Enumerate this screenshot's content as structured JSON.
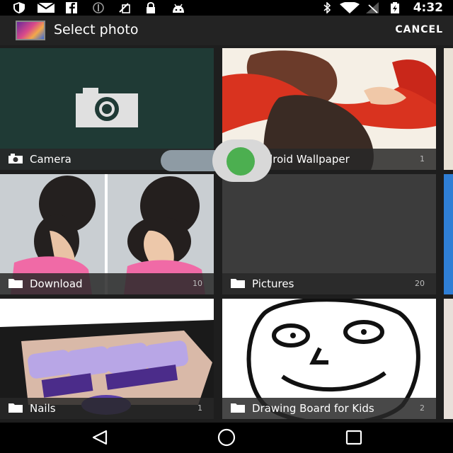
{
  "status_bar": {
    "time": "4:32",
    "icons": [
      "shield-icon",
      "mail-icon",
      "facebook-icon",
      "blocked-icon",
      "no-sim-icon",
      "lock-icon",
      "android-icon",
      "bluetooth-icon",
      "wifi-icon",
      "no-signal-icon",
      "battery-charging-icon"
    ]
  },
  "app_bar": {
    "title": "Select photo",
    "cancel_label": "CANCEL"
  },
  "albums": [
    {
      "name": "Camera",
      "count": "",
      "icon": "camera-icon"
    },
    {
      "name": "Android Wallpaper",
      "count": "1",
      "icon": "folder-icon"
    },
    {
      "name": "Download",
      "count": "10",
      "icon": "folder-icon"
    },
    {
      "name": "Pictures",
      "count": "20",
      "icon": "folder-icon"
    },
    {
      "name": "Nails",
      "count": "1",
      "icon": "folder-icon"
    },
    {
      "name": "Drawing Board for Kids",
      "count": "2",
      "icon": "folder-icon"
    }
  ],
  "nav_bar": {
    "icons": [
      "back-icon",
      "home-icon",
      "recents-icon"
    ]
  },
  "colors": {
    "accent": "#4caf50",
    "appbar": "#232323",
    "background": "#1e1e1e"
  }
}
